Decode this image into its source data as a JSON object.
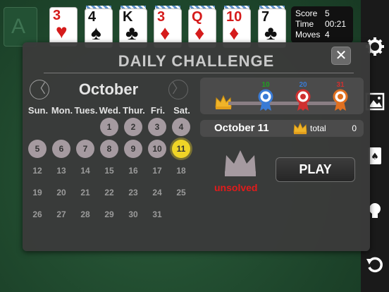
{
  "scoreboard": {
    "score_label": "Score",
    "score_value": "5",
    "time_label": "Time",
    "time_value": "00:21",
    "moves_label": "Moves",
    "moves_value": "4"
  },
  "foundation_letter": "A",
  "tableau_top": [
    {
      "rank": "3",
      "suit": "♥",
      "color": "red"
    },
    {
      "rank": "4",
      "suit": "♠",
      "color": "black"
    },
    {
      "rank": "K",
      "suit": "♣",
      "color": "black"
    },
    {
      "rank": "3",
      "suit": "♦",
      "color": "red"
    },
    {
      "rank": "Q",
      "suit": "♦",
      "color": "red"
    },
    {
      "rank": "10",
      "suit": "♦",
      "color": "red"
    },
    {
      "rank": "7",
      "suit": "♣",
      "color": "black"
    }
  ],
  "modal": {
    "title": "DAILY CHALLENGE",
    "close_glyph": "✕",
    "month": "October",
    "prev_glyph": "〈",
    "next_glyph": "〉",
    "weekdays": [
      "Sun.",
      "Mon.",
      "Tues.",
      "Wed.",
      "Thur.",
      "Fri.",
      "Sat."
    ],
    "days": [
      {
        "n": "1",
        "state": "played"
      },
      {
        "n": "2",
        "state": "played"
      },
      {
        "n": "3",
        "state": "played"
      },
      {
        "n": "4",
        "state": "played"
      },
      {
        "n": "5",
        "state": "played"
      },
      {
        "n": "6",
        "state": "played"
      },
      {
        "n": "7",
        "state": "played"
      },
      {
        "n": "8",
        "state": "played"
      },
      {
        "n": "9",
        "state": "played"
      },
      {
        "n": "10",
        "state": "played"
      },
      {
        "n": "11",
        "state": "today"
      },
      {
        "n": "12",
        "state": "future"
      },
      {
        "n": "13",
        "state": "future"
      },
      {
        "n": "14",
        "state": "future"
      },
      {
        "n": "15",
        "state": "future"
      },
      {
        "n": "16",
        "state": "future"
      },
      {
        "n": "17",
        "state": "future"
      },
      {
        "n": "18",
        "state": "future"
      },
      {
        "n": "19",
        "state": "future"
      },
      {
        "n": "20",
        "state": "future"
      },
      {
        "n": "21",
        "state": "future"
      },
      {
        "n": "22",
        "state": "future"
      },
      {
        "n": "23",
        "state": "future"
      },
      {
        "n": "24",
        "state": "future"
      },
      {
        "n": "25",
        "state": "future"
      },
      {
        "n": "26",
        "state": "future"
      },
      {
        "n": "27",
        "state": "future"
      },
      {
        "n": "28",
        "state": "future"
      },
      {
        "n": "29",
        "state": "future"
      },
      {
        "n": "30",
        "state": "future"
      },
      {
        "n": "31",
        "state": "future"
      }
    ],
    "first_weekday_index": 3,
    "ribbons": [
      {
        "label": "10",
        "color": "#20a020",
        "medal_color": "#3a7bd5"
      },
      {
        "label": "20",
        "color": "#3a7bd5",
        "medal_color": "#d03030"
      },
      {
        "label": "31",
        "color": "#d03030",
        "medal_color": "#e07020"
      }
    ],
    "selected_date": "October 11",
    "total_label": "total",
    "total_value": "0",
    "status": "unsolved",
    "play_label": "PLAY"
  },
  "colors": {
    "accent_today": "#efd427",
    "played": "#a59aa0",
    "status_red": "#e21b1b"
  }
}
